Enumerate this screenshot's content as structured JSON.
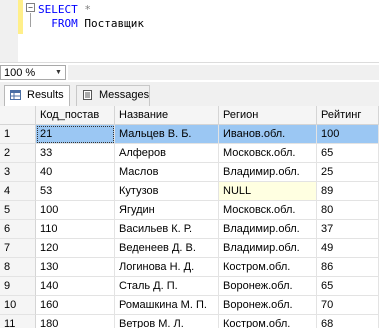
{
  "editor": {
    "line1": {
      "keyword": "SELECT",
      "rest": " *"
    },
    "line2": {
      "keyword": "FROM",
      "rest": " Поставщик"
    }
  },
  "zoom": {
    "value": "100 %"
  },
  "tabs": [
    {
      "label": "Results",
      "icon": "grid-icon"
    },
    {
      "label": "Messages",
      "icon": "messages-icon"
    }
  ],
  "grid": {
    "columns": [
      "Код_постав",
      "Название",
      "Регион",
      "Рейтинг"
    ],
    "rows": [
      {
        "n": "1",
        "cells": [
          "21",
          "Мальцев В. Б.",
          "Иванов.обл.",
          "100"
        ]
      },
      {
        "n": "2",
        "cells": [
          "33",
          "Алферов",
          "Московск.обл.",
          "65"
        ]
      },
      {
        "n": "3",
        "cells": [
          "40",
          "Маслов",
          "Владимир.обл.",
          "25"
        ]
      },
      {
        "n": "4",
        "cells": [
          "53",
          "Кутузов",
          "NULL",
          "89"
        ]
      },
      {
        "n": "5",
        "cells": [
          "100",
          "Ягудин",
          "Московск.обл.",
          "80"
        ]
      },
      {
        "n": "6",
        "cells": [
          "110",
          "Васильев К. Р.",
          "Владимир.обл.",
          "37"
        ]
      },
      {
        "n": "7",
        "cells": [
          "120",
          "Веденеев Д. В.",
          "Владимир.обл.",
          "49"
        ]
      },
      {
        "n": "8",
        "cells": [
          "130",
          "Логинова Н. Д.",
          "Костром.обл.",
          "86"
        ]
      },
      {
        "n": "9",
        "cells": [
          "140",
          "Сталь Д. П.",
          "Воронеж.обл.",
          "65"
        ]
      },
      {
        "n": "10",
        "cells": [
          "160",
          "Ромашкина М. П.",
          "Воронеж.обл.",
          "70"
        ]
      },
      {
        "n": "11",
        "cells": [
          "180",
          "Ветров М. Л.",
          "Костром.обл.",
          "68"
        ]
      }
    ]
  },
  "colors": {
    "selection": "#9bc7f3",
    "keyword": "#0000ff",
    "null_cell": "#ffffe1",
    "margin_marker": "#ffef8a"
  }
}
